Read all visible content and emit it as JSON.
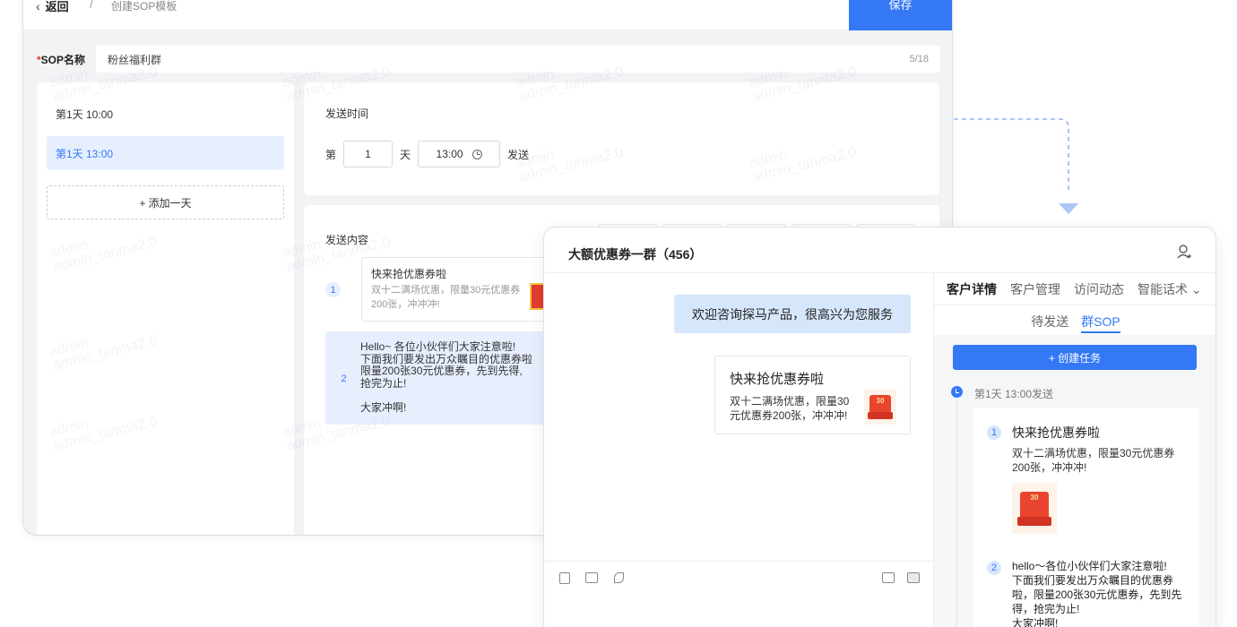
{
  "editor": {
    "back_label": "返回",
    "separator": "/",
    "breadcrumb": "创建SOP模板",
    "save_label": "保存",
    "name_label": "SOP名称",
    "name_value": "粉丝福利群",
    "name_count": "5/18",
    "days": [
      "第1天 10:00",
      "第1天 13:00"
    ],
    "add_day": "+ 添加一天",
    "send_time_title": "发送时间",
    "day_prefix": "第",
    "day_value": "1",
    "day_suffix": "天",
    "time_value": "13:00",
    "send_label": "发送",
    "content_title": "发送内容",
    "msg1_num": "1",
    "msg1_title": "快来抢优惠券啦",
    "msg1_desc": "双十二满场优惠，限量30元优惠券200张，冲冲冲!",
    "msg2_num": "2",
    "msg2_text": "Hello~ 各位小伙伴们大家注意啦!\n下面我们要发出万众瞩目的优惠券啦\n限量200张30元优惠券，先到先得,\n抢完为止!\n\n大家冲啊!"
  },
  "watermark": "admin\nadmin_tanma2.0",
  "chat": {
    "title": "大额优惠券一群（456）",
    "bubble": "欢迎咨询探马产品，很高兴为您服务",
    "card_title": "快来抢优惠券啦",
    "card_desc": "双十二满场优惠，限量30元优惠券200张，冲冲冲!",
    "coupon_text": "30",
    "tabs": [
      "客户详情",
      "客户管理",
      "访问动态",
      "智能话术"
    ],
    "subtabs": [
      "待发送",
      "群SOP"
    ],
    "create_label": "+ 创建任务",
    "timeline_label": "第1天 13:00发送",
    "task1_num": "1",
    "task1_title": "快来抢优惠券啦",
    "task1_desc": "双十二满场优惠，限量30元优惠券200张，冲冲冲!",
    "task2_num": "2",
    "task2_text": "hello～各位小伙伴们大家注意啦!\n下面我们要发出万众瞩目的优惠券啦，限量200张30元优惠券，先到先得，抢完为止!\n大家冲啊!"
  },
  "colors": {
    "accent": "#3478f6",
    "selected_bg": "#e7efff",
    "bubble_bg": "#d6e6fb"
  },
  "icons": [
    "back-chevron-icon",
    "clock-icon",
    "user-icon",
    "chevron-down-icon",
    "word-icon",
    "folder-icon",
    "phone-icon",
    "screen-icon",
    "panel-icon"
  ]
}
